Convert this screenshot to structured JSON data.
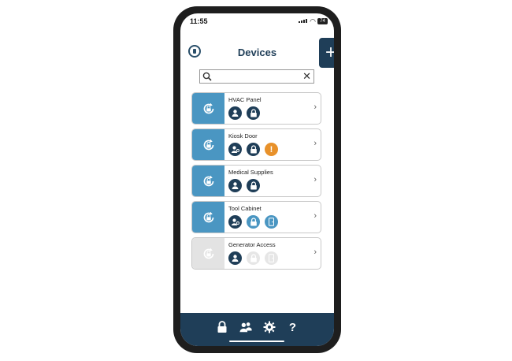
{
  "status": {
    "time": "11:55",
    "battery": "74"
  },
  "header": {
    "title": "Devices",
    "add_label": "+"
  },
  "search": {
    "placeholder": "",
    "clear_label": "✕"
  },
  "devices": [
    {
      "name": "HVAC Panel",
      "enabled": true,
      "icons": [
        "user",
        "lock"
      ]
    },
    {
      "name": "Kiosk Door",
      "enabled": true,
      "icons": [
        "user-key",
        "lock",
        "alert"
      ]
    },
    {
      "name": "Medical Supplies",
      "enabled": true,
      "icons": [
        "user",
        "lock"
      ]
    },
    {
      "name": "Tool Cabinet",
      "enabled": true,
      "icons": [
        "user-key",
        "lock-light",
        "door-light"
      ]
    },
    {
      "name": "Generator Access",
      "enabled": false,
      "icons": [
        "user",
        "lock-faded",
        "door-faded"
      ]
    }
  ],
  "footer": {
    "tabs": [
      "lock-icon",
      "users-icon",
      "gear-icon",
      "help-icon"
    ],
    "help_label": "?"
  },
  "colors": {
    "primary": "#1f3e58",
    "accent": "#4a96c2",
    "warning": "#e8912a"
  }
}
